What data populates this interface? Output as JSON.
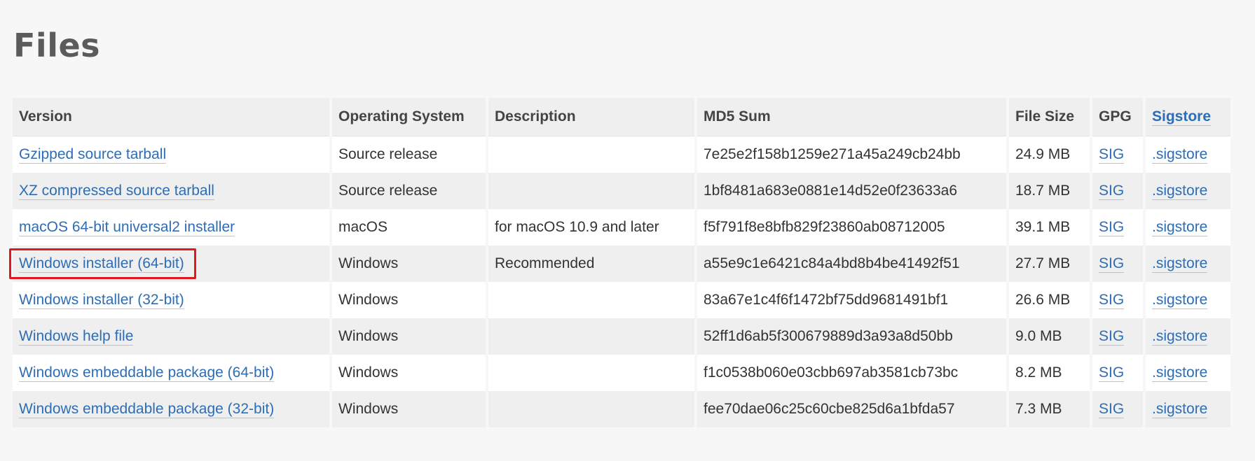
{
  "page": {
    "title": "Files"
  },
  "table": {
    "headers": {
      "version": "Version",
      "os": "Operating System",
      "description": "Description",
      "md5": "MD5 Sum",
      "size": "File Size",
      "gpg": "GPG",
      "sigstore": "Sigstore"
    },
    "rows": [
      {
        "version": "Gzipped source tarball",
        "os": "Source release",
        "description": "",
        "md5": "7e25e2f158b1259e271a45a249cb24bb",
        "size": "24.9 MB",
        "gpg": "SIG",
        "sigstore": ".sigstore"
      },
      {
        "version": "XZ compressed source tarball",
        "os": "Source release",
        "description": "",
        "md5": "1bf8481a683e0881e14d52e0f23633a6",
        "size": "18.7 MB",
        "gpg": "SIG",
        "sigstore": ".sigstore"
      },
      {
        "version": "macOS 64-bit universal2 installer",
        "os": "macOS",
        "description": "for macOS 10.9 and later",
        "md5": "f5f791f8e8bfb829f23860ab08712005",
        "size": "39.1 MB",
        "gpg": "SIG",
        "sigstore": ".sigstore"
      },
      {
        "version": "Windows installer (64-bit)",
        "os": "Windows",
        "description": "Recommended",
        "md5": "a55e9c1e6421c84a4bd8b4be41492f51",
        "size": "27.7 MB",
        "gpg": "SIG",
        "sigstore": ".sigstore"
      },
      {
        "version": "Windows installer (32-bit)",
        "os": "Windows",
        "description": "",
        "md5": "83a67e1c4f6f1472bf75dd9681491bf1",
        "size": "26.6 MB",
        "gpg": "SIG",
        "sigstore": ".sigstore"
      },
      {
        "version": "Windows help file",
        "os": "Windows",
        "description": "",
        "md5": "52ff1d6ab5f300679889d3a93a8d50bb",
        "size": "9.0 MB",
        "gpg": "SIG",
        "sigstore": ".sigstore"
      },
      {
        "version": "Windows embeddable package (64-bit)",
        "os": "Windows",
        "description": "",
        "md5": "f1c0538b060e03cbb697ab3581cb73bc",
        "size": "8.2 MB",
        "gpg": "SIG",
        "sigstore": ".sigstore"
      },
      {
        "version": "Windows embeddable package (32-bit)",
        "os": "Windows",
        "description": "",
        "md5": "fee70dae06c25c60cbe825d6a1bfda57",
        "size": "7.3 MB",
        "gpg": "SIG",
        "sigstore": ".sigstore"
      }
    ]
  },
  "colors": {
    "link": "#2e6db4",
    "link_underline": "#e8c352",
    "highlight_box": "#e0191e",
    "title": "#5b5b5b"
  }
}
